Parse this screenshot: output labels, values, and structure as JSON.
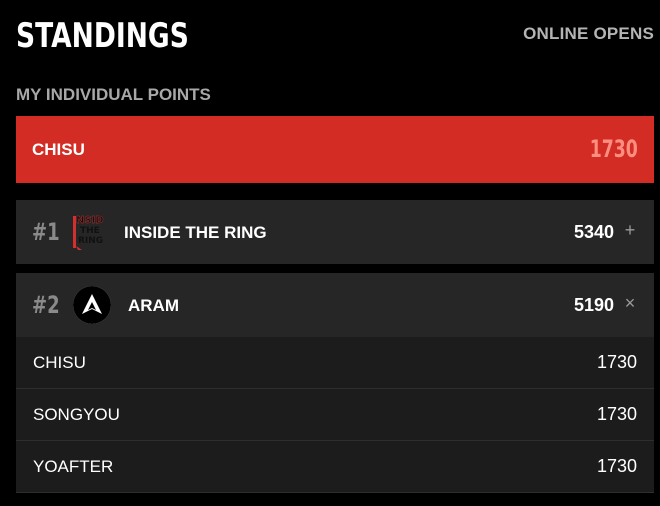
{
  "header": {
    "title": "STANDINGS",
    "link_label": "ONLINE OPENS"
  },
  "my_points": {
    "section_label": "MY INDIVIDUAL POINTS",
    "player": "CHISU",
    "points": "1730",
    "accent_color": "#d22c24"
  },
  "teams": [
    {
      "rank": "#1",
      "name": "INSIDE THE RING",
      "points": "5340",
      "logo_icon": "inside-the-ring-logo",
      "logo_text": "INSIDE THE RING",
      "toggle_icon": "plus-icon",
      "toggle_glyph": "+",
      "expanded": false
    },
    {
      "rank": "#2",
      "name": "ARAM",
      "points": "5190",
      "logo_icon": "apex-triangle-logo",
      "toggle_icon": "close-icon",
      "toggle_glyph": "×",
      "expanded": true,
      "members": [
        {
          "name": "CHISU",
          "points": "1730"
        },
        {
          "name": "SONGYOU",
          "points": "1730"
        },
        {
          "name": "YOAFTER",
          "points": "1730"
        }
      ]
    }
  ]
}
